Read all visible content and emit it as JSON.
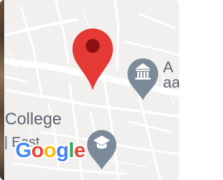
{
  "map": {
    "place_label_primary": "College",
    "place_label_secondary": "| East",
    "poi_label_partial": "A",
    "poi_label_partial_line2": "aa",
    "poi_icon": "museum-icon",
    "poi_icon_2": "school-icon",
    "poi_badge": "1",
    "marker_icon": "map-pin-icon",
    "marker_color": "#e53935",
    "poi_color": "#7b8a99",
    "land_color": "#f1f0ee",
    "road_color": "#ffffff"
  },
  "branding": {
    "logo_text": "Google",
    "logo_colors": [
      "#4285F4",
      "#EA4335",
      "#FBBC05",
      "#4285F4",
      "#34A853",
      "#EA4335"
    ]
  }
}
